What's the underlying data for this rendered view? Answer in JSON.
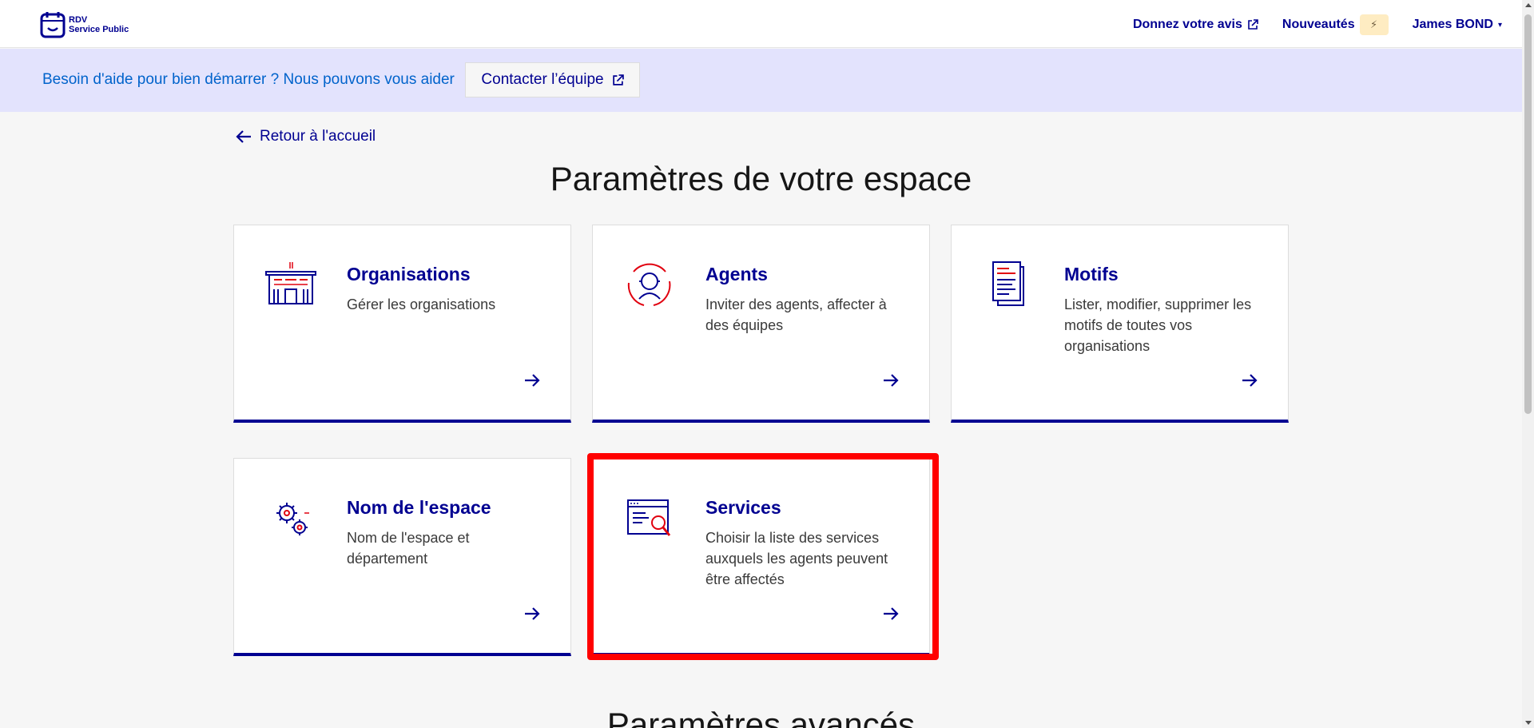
{
  "header": {
    "logo_line1": "RDV",
    "logo_line2": "Service Public",
    "feedback_label": "Donnez votre avis",
    "news_label": "Nouveautés",
    "user_label": "James BOND"
  },
  "help_banner": {
    "text": "Besoin d'aide pour bien démarrer ? Nous pouvons vous aider",
    "contact_label": "Contacter l’équipe"
  },
  "main": {
    "back_label": "Retour à l'accueil",
    "page_title": "Paramètres de votre espace",
    "advanced_title": "Paramètres avancés",
    "cards": [
      {
        "title": "Organisations",
        "description": "Gérer les organisations",
        "icon": "building-icon"
      },
      {
        "title": "Agents",
        "description": "Inviter des agents, affecter à des équipes",
        "icon": "agent-icon"
      },
      {
        "title": "Motifs",
        "description": "Lister, modifier, supprimer les motifs de toutes vos organisations",
        "icon": "document-icon"
      },
      {
        "title": "Nom de l'espace",
        "description": "Nom de l'espace et département",
        "icon": "gears-icon"
      },
      {
        "title": "Services",
        "description": "Choisir la liste des services auxquels les agents peuvent être affectés",
        "icon": "search-window-icon"
      }
    ]
  },
  "colors": {
    "primary": "#000091",
    "accent_red": "#e1000f",
    "banner_bg": "#e3e3fd",
    "highlight": "#ff0000"
  }
}
